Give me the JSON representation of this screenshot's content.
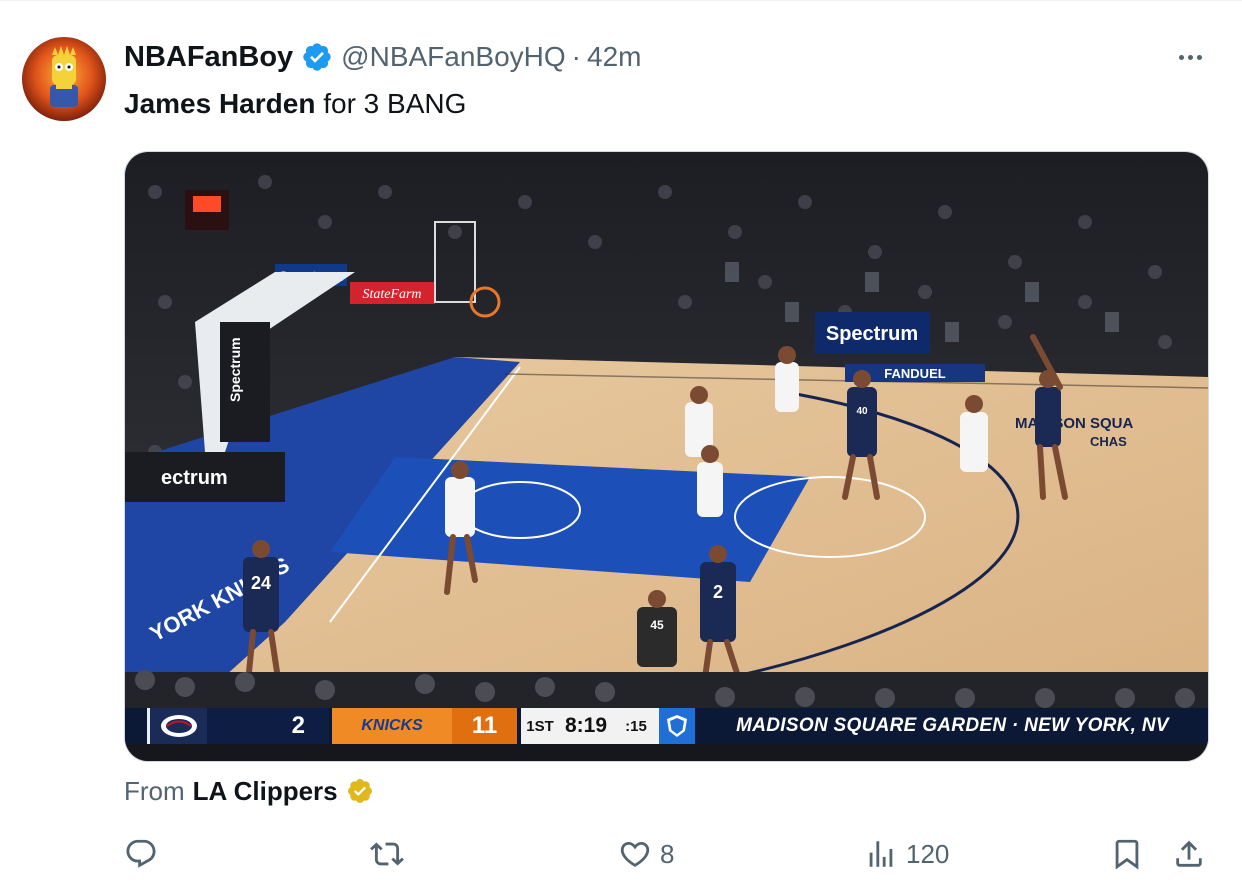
{
  "author": {
    "display_name": "NBAFanBoy",
    "handle": "@NBAFanBoyHQ",
    "separator": "·",
    "time": "42m",
    "verified": true,
    "avatar_icon": "avatar-cartoon-icon"
  },
  "tweet": {
    "text_bold": "James Harden",
    "text_rest": " for 3 BANG"
  },
  "video": {
    "arena_ads": {
      "spectrum_top": "Spectrum",
      "statefarm": "StateFarm",
      "spectrum_stanchion": "Spectrum",
      "spectrum_side": "ectrum",
      "spectrum_baseline": "Spectrum",
      "fanduel": "FANDUEL",
      "garden_sign_line1": "MADISON SQUA",
      "garden_sign_line2": "CHAS",
      "sideline_text": "YORK KNICKS"
    },
    "scoreboard": {
      "away_score": "2",
      "home_logo_text": "KNICKS",
      "home_score": "11",
      "period": "1ST",
      "clock": "8:19",
      "shot_clock": ":15",
      "venue": "MADISON SQUARE GARDEN · NEW YORK, NV"
    },
    "jerseys": {
      "player_left": "24",
      "player_center": "2",
      "referee": "45",
      "player_top": "40"
    }
  },
  "attribution": {
    "prefix": "From",
    "name": "LA Clippers",
    "badge_color": "#e2b719"
  },
  "actions": {
    "reply_count": "",
    "retweet_count": "",
    "like_count": "8",
    "views_count": "120"
  },
  "colors": {
    "accent": "#1d9bf0",
    "secondary_text": "#536471"
  }
}
